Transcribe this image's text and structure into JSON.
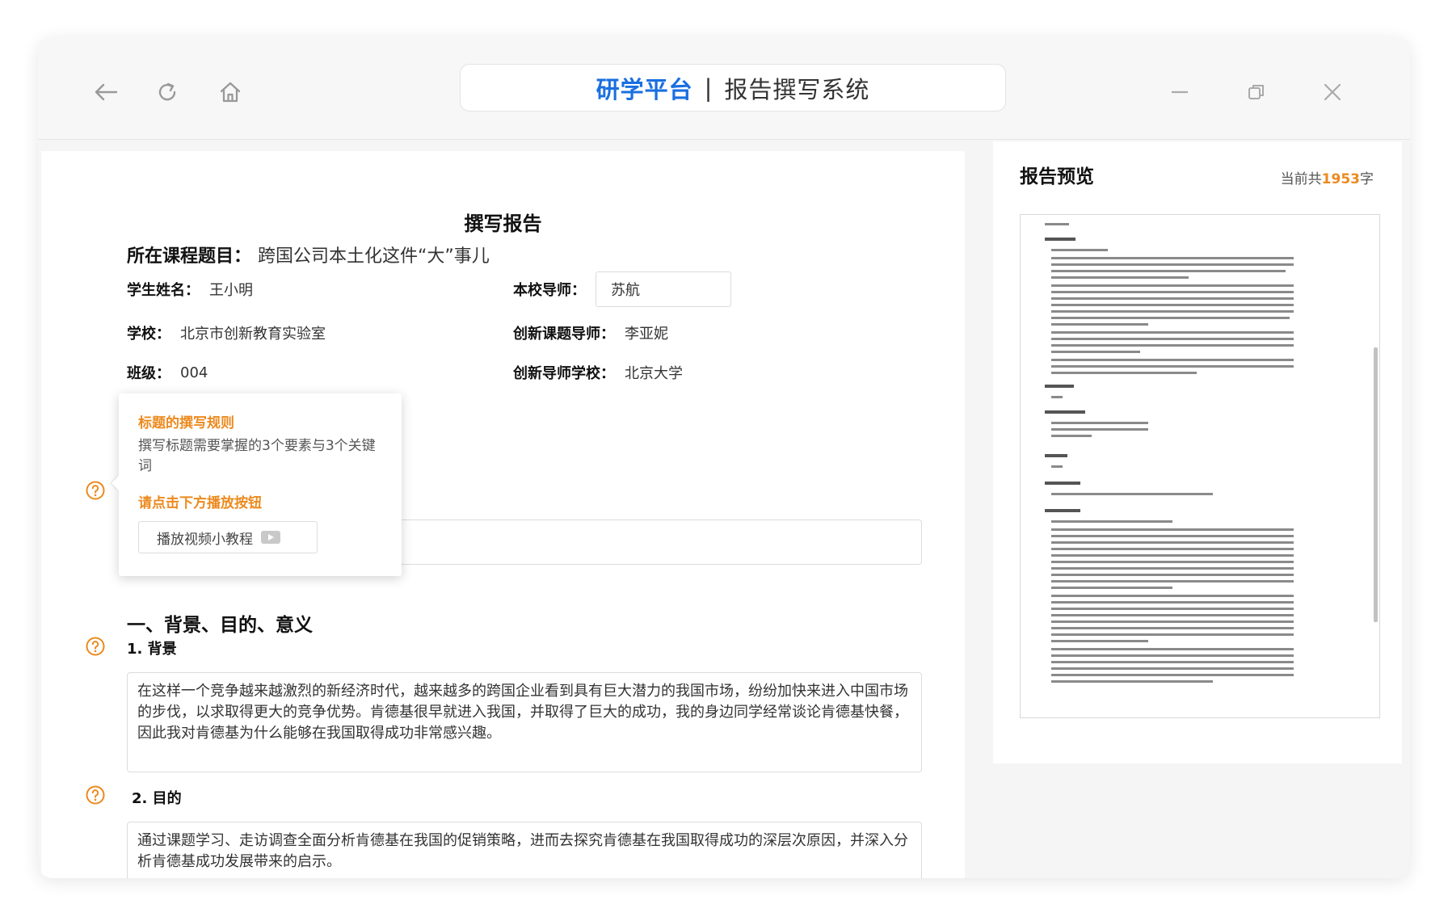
{
  "titlebar": {
    "brand": "研学平台",
    "separator": "|",
    "system_name": "报告撰写系统"
  },
  "form": {
    "title": "撰写报告",
    "course_label": "所在课程题目：",
    "course_value": "跨国公司本土化这件“大”事儿",
    "student_label": "学生姓名：",
    "student_value": "王小明",
    "teacher_label": "本校导师：",
    "teacher_value": "苏航",
    "school_label": "学校：",
    "school_value": "北京市创新教育实验室",
    "innovation_teacher_label": "创新课题导师：",
    "innovation_teacher_value": "李亚妮",
    "class_label": "班级：",
    "class_value": "004",
    "innovation_school_label": "创新导师学校：",
    "innovation_school_value": "北京大学",
    "section1": "一、背景、目的、意义",
    "sub1": "1. 背景",
    "background_text": "在这样一个竞争越来越激烈的新经济时代，越来越多的跨国企业看到具有巨大潜力的我国市场，纷纷加快来进入中国市场的步伐，以求取得更大的竞争优势。肯德基很早就进入我国，并取得了巨大的成功，我的身边同学经常谈论肯德基快餐，因此我对肯德基为什么能够在我国取得成功非常感兴趣。",
    "sub2": "2. 目的",
    "purpose_text": "通过课题学习、走访调查全面分析肯德基在我国的促销策略，进而去探究肯德基在我国取得成功的深层次原因，并深入分析肯德基成功发展带来的启示。"
  },
  "popover": {
    "heading": "标题的撰写规则",
    "text": "撰写标题需要掌握的3个要素与3个关键词",
    "heading2": "请点击下方播放按钮",
    "button_label": "播放视频小教程"
  },
  "preview": {
    "title": "报告预览",
    "count_prefix": "当前共",
    "count_value": "1953",
    "count_suffix": "字"
  },
  "colors": {
    "brand_blue": "#1a6fe0",
    "accent_orange": "#ec8a1e"
  }
}
